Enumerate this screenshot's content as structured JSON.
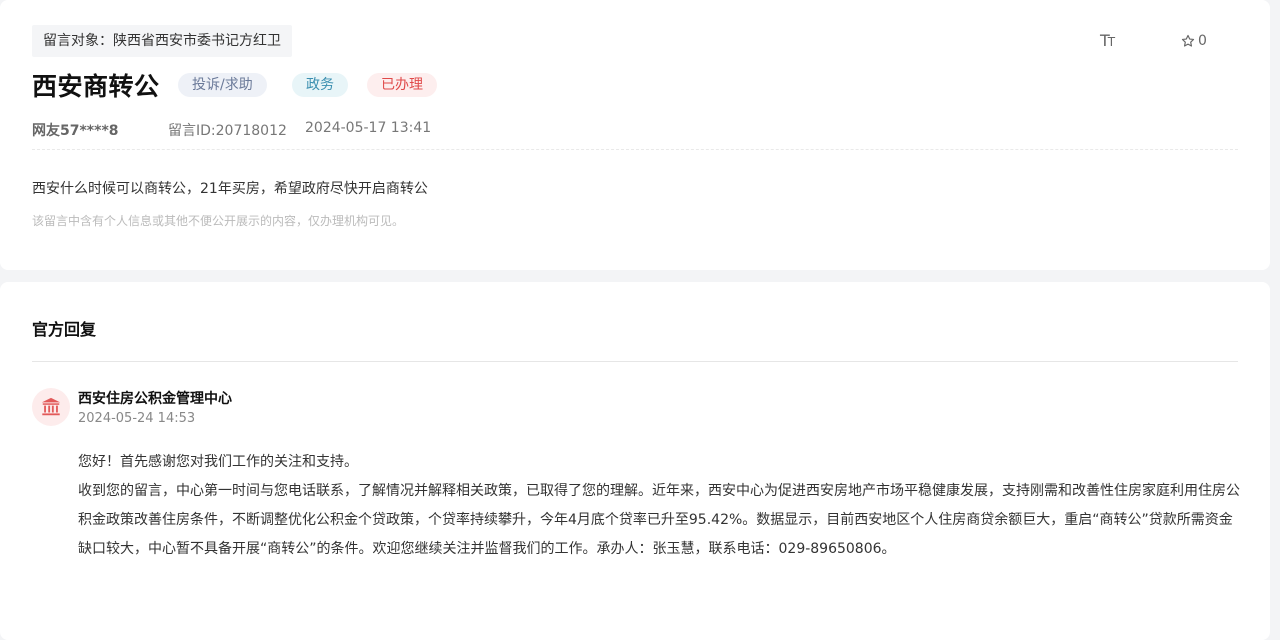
{
  "message": {
    "target_label": "留言对象：陕西省西安市委书记方红卫",
    "font_toggle": {
      "big": "T",
      "small": "T"
    },
    "favorite_count": "0",
    "title": "西安商转公",
    "tags": {
      "type": "投诉/求助",
      "category": "政务",
      "status": "已办理"
    },
    "user": "网友57****8",
    "message_id": "留言ID:20718012",
    "time": "2024-05-17 13:41",
    "content": "西安什么时候可以商转公，21年买房，希望政府尽快开启商转公",
    "privacy_note": "该留言中含有个人信息或其他不便公开展示的内容，仅办理机构可见。"
  },
  "reply": {
    "heading": "官方回复",
    "org_name": "西安住房公积金管理中心",
    "time": "2024-05-24 14:53",
    "paragraphs": [
      "您好！首先感谢您对我们工作的关注和支持。",
      "收到您的留言，中心第一时间与您电话联系，了解情况并解释相关政策，已取得了您的理解。近年来，西安中心为促进西安房地产市场平稳健康发展，支持刚需和改善性住房家庭利用住房公积金政策改善住房条件，不断调整优化公积金个贷政策，个贷率持续攀升，今年4月底个贷率已升至95.42%。数据显示，目前西安地区个人住房商贷余额巨大，重启“商转公”贷款所需资金缺口较大，中心暂不具备开展“商转公”的条件。欢迎您继续关注并监督我们的工作。承办人：张玉慧，联系电话：029-89650806。"
    ]
  },
  "colors": {
    "status_red": "#e04a4a",
    "category_blue": "#3b8fb0",
    "avatar_bg": "#fdecec",
    "avatar_icon": "#e25a5a"
  }
}
